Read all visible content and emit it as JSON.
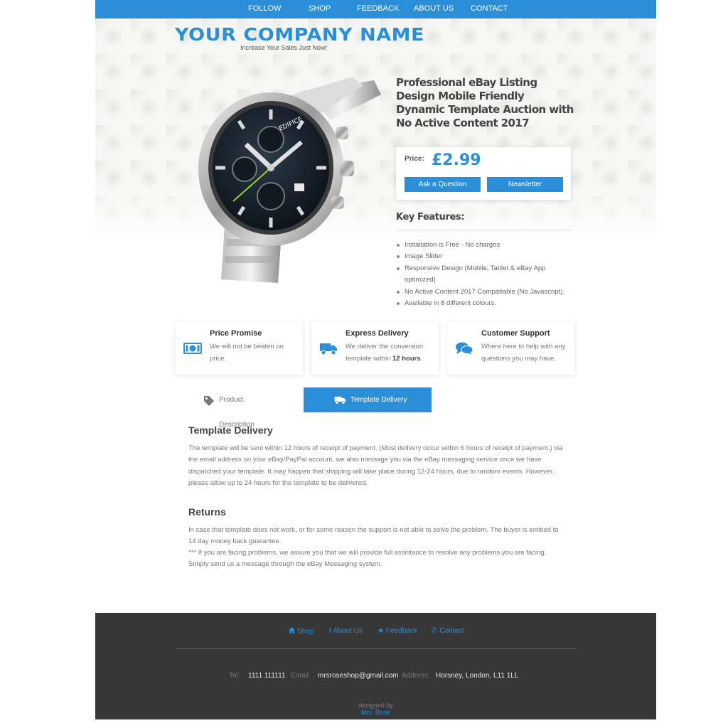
{
  "nav": {
    "items": [
      {
        "label": "FOLLOW"
      },
      {
        "label": "SHOP"
      },
      {
        "label": "FEEDBACK"
      },
      {
        "label": "ABOUT US"
      },
      {
        "label": "CONTACT"
      }
    ]
  },
  "brand": {
    "company_name": "YOUR COMPANY NAME",
    "tagline": "Increase Your Sales Just Now!"
  },
  "product": {
    "title": "Professional eBay Listing Design Mobile Friendly Dynamic Template Auction with No Active Content 2017",
    "image_icon": "wristwatch-image",
    "price_label": "Price:",
    "price_value": "£2.99",
    "ask_label": "Ask a Question",
    "newsletter_label": "Newsletter"
  },
  "key_features": {
    "title": "Key Features:",
    "items": [
      "Installation is Free - No charges",
      "Image Slider",
      "Responsive Design (Mobile, Tablet & eBay App optimized)",
      "No Active Content 2017 Compatiable (No Javascript).",
      "Available in 8 different colours."
    ]
  },
  "features": [
    {
      "icon": "money-icon",
      "title": "Price Promise",
      "text": "We will not be beaten on price."
    },
    {
      "icon": "truck-icon",
      "title": "Express Delivery",
      "text_before": "We deliver the conversion template within ",
      "text_bold": "12 hours",
      "text_after": "."
    },
    {
      "icon": "chat-icon",
      "title": "Customer Support",
      "text": "Where here to help with any questions you may have."
    }
  ],
  "tabs": {
    "description_label": "Product Description",
    "delivery_label": "Template Delivery",
    "active": "Template Delivery"
  },
  "delivery_section": {
    "title": "Template Delivery",
    "text": "The template will be sent within 12 hours of receipt of payment. (Most delivery occur within 6 hours of receipt of payment.) via the email address on your eBay/PayPal account, we also message you via the eBay messaging service once we have dispatched your template. It may happen that shipping will take place during 12-24 hours, due to random events. However, please allow up to 24 hours for the template to be delivered."
  },
  "returns_section": {
    "title": "Returns",
    "text": "In case that template does not work, or for some reason the support is not able to solve the problem. The buyer is entitled to 14 day money back guarantee.",
    "note": "*** If you are facing problems, we assure you that we will provide full assistance to resolve any problems you are facing. Simply send us a message through the eBay Messaging system."
  },
  "footer": {
    "links": [
      {
        "icon": "home-icon",
        "label": "Shop"
      },
      {
        "icon": "info-icon",
        "label": "About Us"
      },
      {
        "icon": "star-icon",
        "label": "Feedback"
      },
      {
        "icon": "phone-icon",
        "label": "Contact"
      }
    ],
    "tel_label": "Tel:",
    "tel_value": "1111 111111",
    "email_label": "Email:",
    "email_value": "mrsroseshop@gmail.com",
    "address_label": "Address:",
    "address_value": "Horsney, London, L11 1LL",
    "designed_by": "designed by",
    "designer": "Mrs. Rose"
  },
  "colors": {
    "accent": "#2a8fd8",
    "footer_bg": "#373737",
    "heading": "#444444",
    "body_text": "#777777"
  }
}
